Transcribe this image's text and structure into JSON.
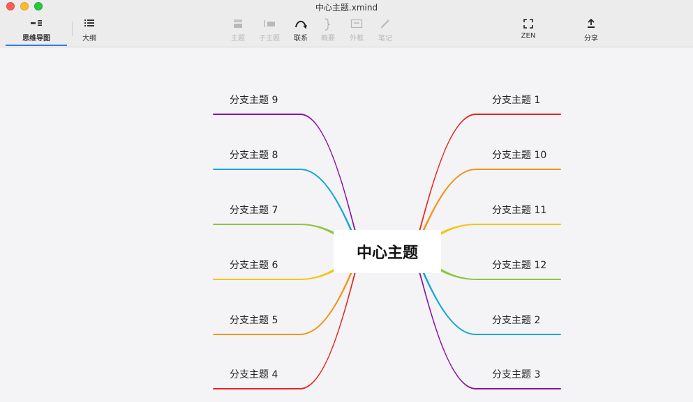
{
  "window": {
    "title": "中心主题.xmind"
  },
  "views": [
    {
      "label": "思维导图",
      "icon": "mindmap-view-icon"
    },
    {
      "label": "大纲",
      "icon": "outline-view-icon"
    }
  ],
  "tools": [
    {
      "label": "主题",
      "icon": "topic-icon",
      "enabled": false
    },
    {
      "label": "子主题",
      "icon": "subtopic-icon",
      "enabled": false
    },
    {
      "label": "联系",
      "icon": "relationship-icon",
      "enabled": true
    },
    {
      "label": "概要",
      "icon": "summary-brace-icon",
      "enabled": false
    },
    {
      "label": "外框",
      "icon": "boundary-icon",
      "enabled": false
    },
    {
      "label": "笔记",
      "icon": "note-pen-icon",
      "enabled": false
    }
  ],
  "zen": {
    "label": "ZEN",
    "icon": "zen-focus-icon"
  },
  "share": {
    "label": "分享",
    "icon": "share-upload-icon"
  },
  "map": {
    "central": "中心主题",
    "left_branches": [
      {
        "label": "分支主题 9",
        "color": "#8e12a6"
      },
      {
        "label": "分支主题 8",
        "color": "#17a8d6"
      },
      {
        "label": "分支主题 7",
        "color": "#8cc63e"
      },
      {
        "label": "分支主题 6",
        "color": "#f5c518"
      },
      {
        "label": "分支主题 5",
        "color": "#f39512"
      },
      {
        "label": "分支主题 4",
        "color": "#e8231c"
      }
    ],
    "right_branches": [
      {
        "label": "分支主题 1",
        "color": "#e8231c"
      },
      {
        "label": "分支主题 10",
        "color": "#f39512"
      },
      {
        "label": "分支主题 11",
        "color": "#f5c518"
      },
      {
        "label": "分支主题 12",
        "color": "#8cc63e"
      },
      {
        "label": "分支主题 2",
        "color": "#17a8d6"
      },
      {
        "label": "分支主题 3",
        "color": "#8e12a6"
      }
    ]
  }
}
